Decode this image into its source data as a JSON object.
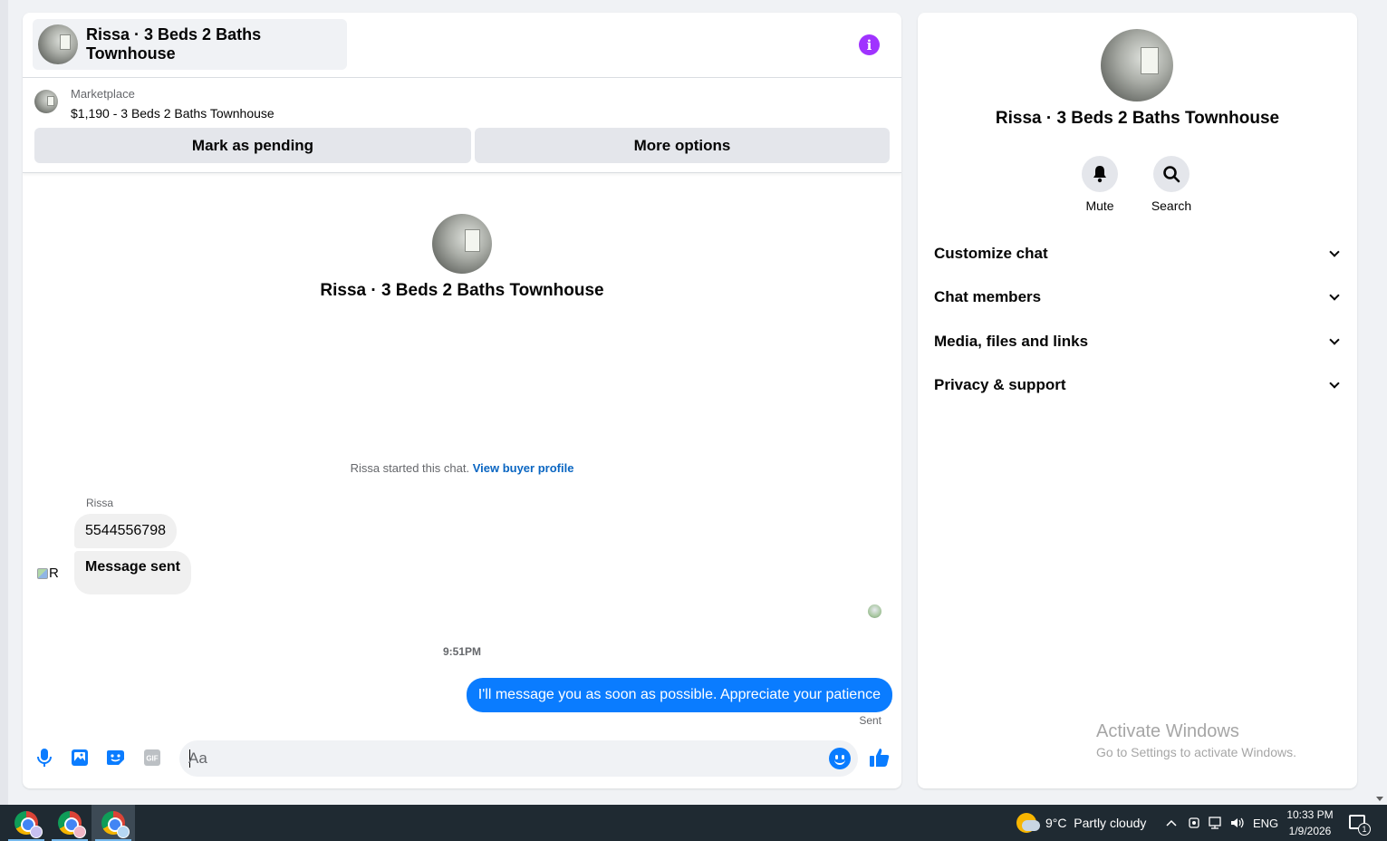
{
  "chat": {
    "header_title": "Rissa · 3 Beds 2 Baths Townhouse",
    "listing_source": "Marketplace",
    "listing_title": "$1,190 - 3 Beds 2 Baths Townhouse",
    "mark_pending_label": "Mark as pending",
    "more_options_label": "More options",
    "intro_name": "Rissa · 3 Beds 2 Baths Townhouse",
    "started_text": "Rissa started this chat.",
    "view_buyer_profile": "View buyer profile",
    "sender_name": "Rissa",
    "avatar_alt": "R",
    "incoming_messages": [
      "5544556798",
      "Message sent"
    ],
    "timestamp": "9:51PM",
    "outgoing_message": "I'll message you as soon as possible. Appreciate your patience",
    "sent_status": "Sent",
    "composer_placeholder": "Aa",
    "composer_icons": [
      "microphone-icon",
      "image-icon",
      "sticker-icon",
      "gif-icon",
      "emoji-icon",
      "thumbs-up-icon"
    ],
    "gif_label": "GIF"
  },
  "info_panel": {
    "name": "Rissa · 3 Beds 2 Baths Townhouse",
    "mute_label": "Mute",
    "search_label": "Search",
    "sections": [
      "Customize chat",
      "Chat members",
      "Media, files and links",
      "Privacy & support"
    ]
  },
  "watermark": {
    "line1": "Activate Windows",
    "line2": "Go to Settings to activate Windows."
  },
  "taskbar": {
    "weather": "9°C  Partly cloudy",
    "language": "ENG",
    "time": "10:33 PM",
    "date": "1/9/2026",
    "notification_count": "1"
  },
  "colors": {
    "accent_blue": "#0a7cff",
    "info_purple": "#a033ff",
    "link_blue": "#0a66c2",
    "page_bg": "#f0f2f5"
  }
}
